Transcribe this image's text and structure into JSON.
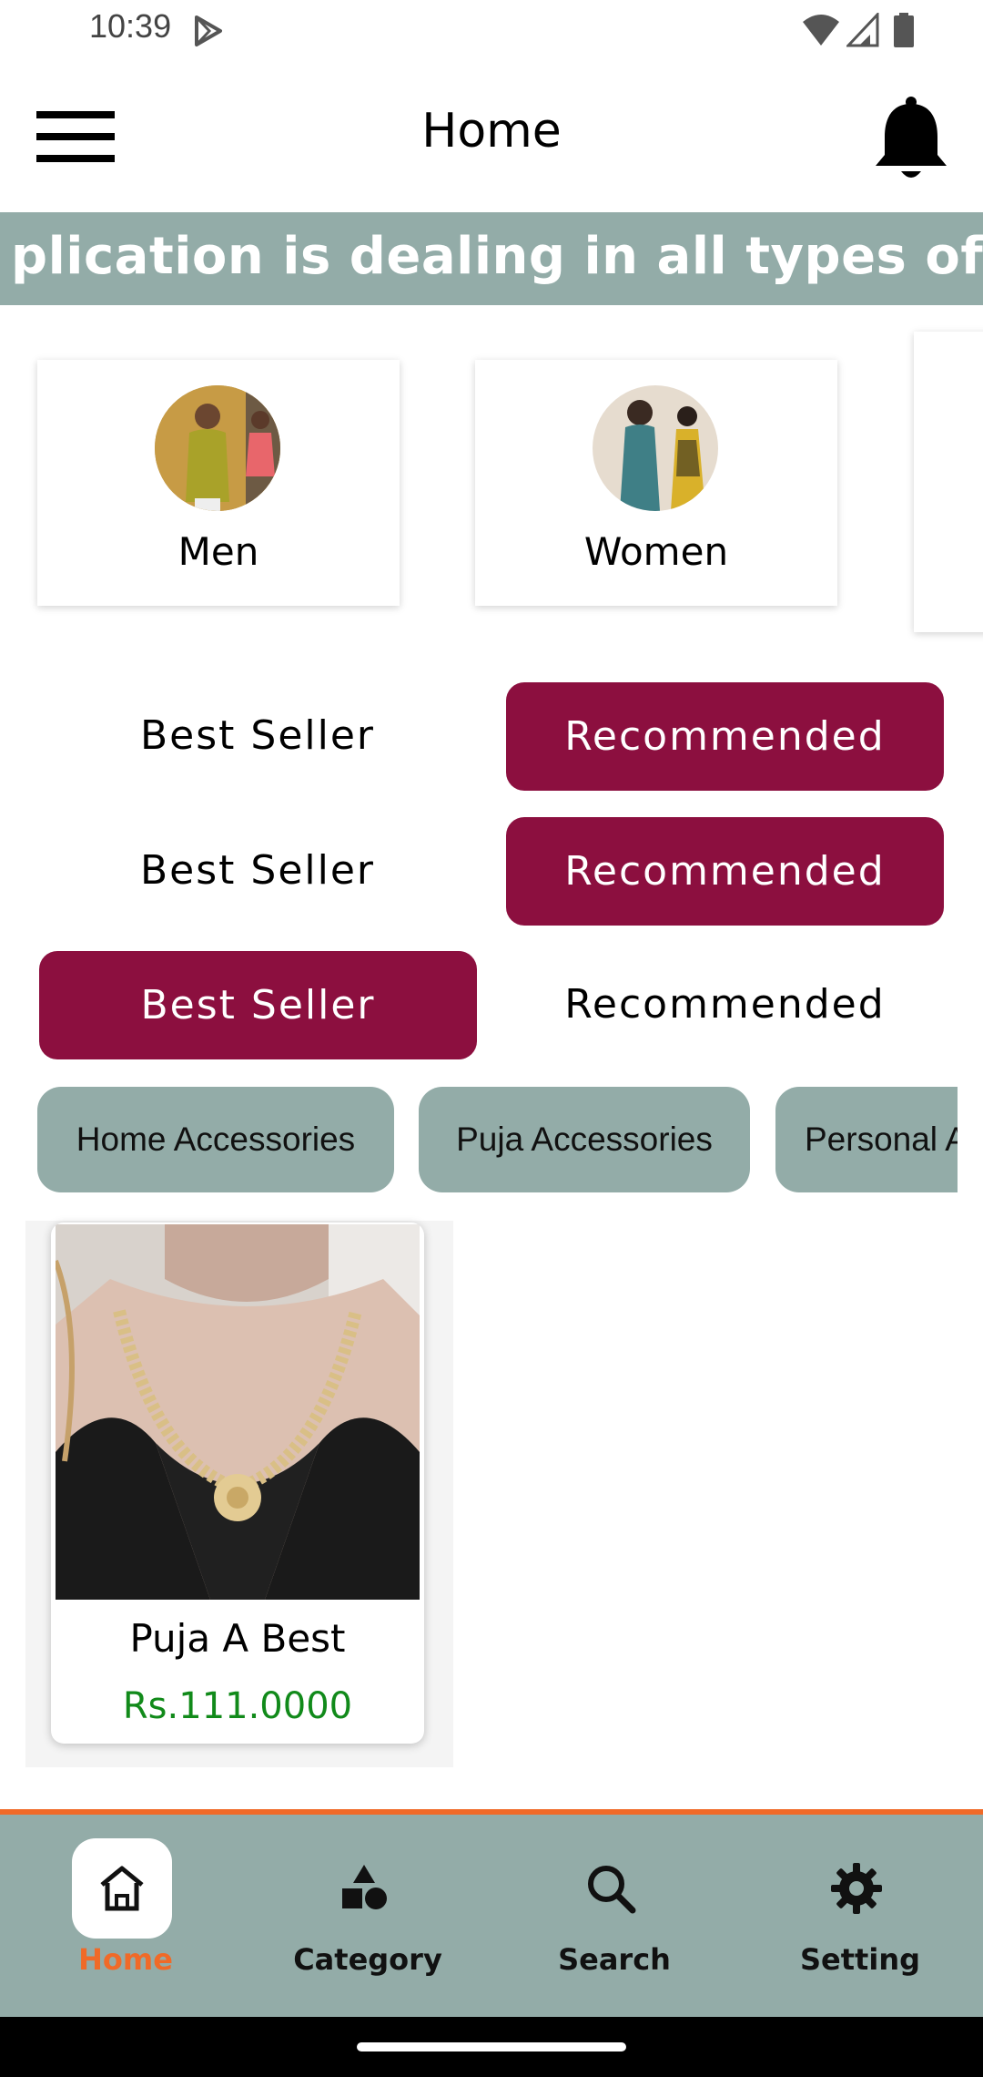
{
  "status_bar": {
    "time": "10:39"
  },
  "app_bar": {
    "title": "Home"
  },
  "marquee": {
    "text": "plication is dealing in all types of fashio"
  },
  "categories": [
    {
      "label": "Men"
    },
    {
      "label": "Women"
    }
  ],
  "toggle_rows": [
    {
      "left": "Best Seller",
      "right": "Recommended",
      "selected": "right"
    },
    {
      "left": "Best Seller",
      "right": "Recommended",
      "selected": "right"
    },
    {
      "left": "Best Seller",
      "right": "Recommended",
      "selected": "left"
    }
  ],
  "chips": [
    "Home Accessories",
    "Puja Accessories",
    "Personal A"
  ],
  "product": {
    "name": "Puja A Best",
    "price": "Rs.111.0000"
  },
  "bottom_nav": {
    "items": [
      {
        "label": "Home",
        "icon": "home-icon",
        "active": true
      },
      {
        "label": "Category",
        "icon": "category-icon",
        "active": false
      },
      {
        "label": "Search",
        "icon": "search-icon",
        "active": false
      },
      {
        "label": "Setting",
        "icon": "gear-icon",
        "active": false
      }
    ]
  },
  "colors": {
    "accent": "#8c0f3f",
    "teal_gray": "#93aca8",
    "nav_active": "#f06a28",
    "price_green": "#118a1a"
  }
}
